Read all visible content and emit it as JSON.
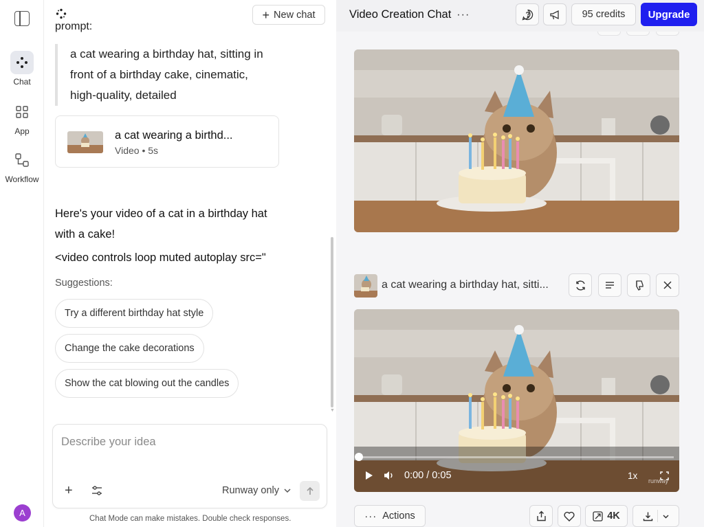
{
  "rail": {
    "items": [
      {
        "label": "Chat",
        "icon": "chat-dots-icon",
        "active": true
      },
      {
        "label": "App",
        "icon": "grid-icon",
        "active": false
      },
      {
        "label": "Workflow",
        "icon": "workflow-icon",
        "active": false
      }
    ],
    "avatar_initial": "A",
    "avatar_color": "#9b3fd0"
  },
  "chat": {
    "new_chat_label": "New chat",
    "prompt_fragment": "prompt:",
    "quoted_prompt": "a cat wearing a birthday hat, sitting in front of a birthday cake, cinematic, high-quality, detailed",
    "video_card": {
      "title": "a cat wearing a birthd...",
      "meta": "Video • 5s"
    },
    "response_text": "Here's your video of a cat in a birthday hat with a cake!",
    "response_code": "<video controls loop muted autoplay src=\"",
    "suggestions_label": "Suggestions:",
    "suggestions": [
      "Try a different birthday hat style",
      "Change the cake decorations",
      "Show the cat blowing out the candles"
    ],
    "composer": {
      "placeholder": "Describe your idea",
      "model_label": "Runway only"
    },
    "disclaimer": "Chat Mode can make mistakes. Double check responses."
  },
  "panel": {
    "title": "Video Creation Chat",
    "title_menu": "···",
    "credits_label": "95 credits",
    "upgrade_label": "Upgrade",
    "accent_color": "#1f1fef",
    "item_title": "a cat wearing a birthday hat, sitti...",
    "video_player": {
      "time": "0:00 / 0:05",
      "speed": "1x",
      "watermark": "runway",
      "progress": 0
    },
    "bottom": {
      "actions_label": "Actions",
      "resolution_label": "4K"
    }
  }
}
